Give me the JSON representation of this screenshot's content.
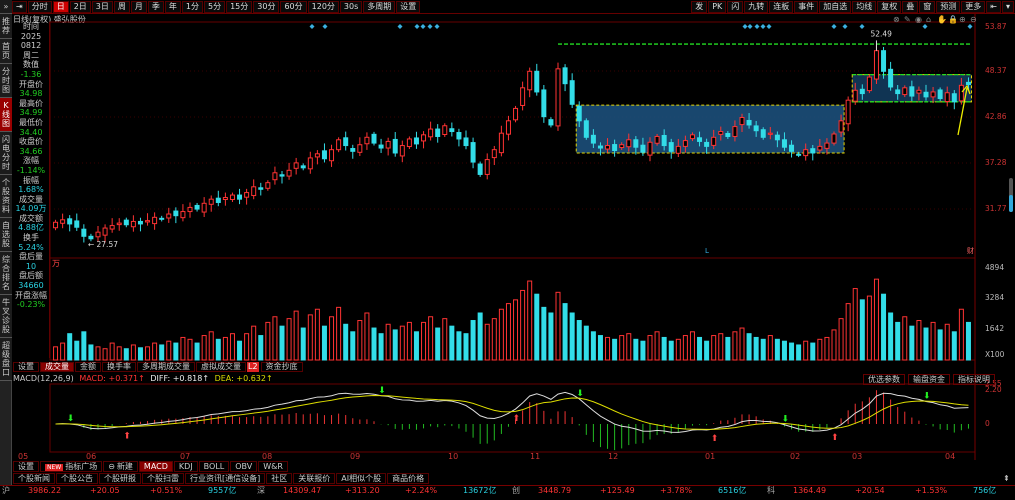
{
  "toolbar": {
    "items": [
      "分时",
      "日",
      "2日",
      "3日",
      "周",
      "月",
      "季",
      "年",
      "1分",
      "5分",
      "15分",
      "30分",
      "60分",
      "120分",
      "30s",
      "多周期",
      "设置"
    ],
    "active": 1,
    "right_items": [
      "发",
      "PK",
      "闪",
      "九转",
      "连板",
      "事件",
      "加自选",
      "均线",
      "复权",
      "叠",
      "窗",
      "预测",
      "更多"
    ]
  },
  "title": "日线(复权)  盛弘股份",
  "sidebar": [
    "推荐",
    "首页",
    "分时图",
    "K线图",
    "闪电分时",
    "个股资料",
    "自选股",
    "综合排名",
    "牛叉诊股",
    "超级盘口"
  ],
  "sidebar_active": 3,
  "info": [
    {
      "label": "时间",
      "value": "2025",
      "value2": "0812",
      "value3": "周二",
      "cls": "lbl"
    },
    {
      "label": "数值",
      "value": "-1.36",
      "cls": "g"
    },
    {
      "label": "开盘价",
      "value": "34.98",
      "cls": "g"
    },
    {
      "label": "最高价",
      "value": "34.99",
      "cls": "g"
    },
    {
      "label": "最低价",
      "value": "34.40",
      "cls": "g"
    },
    {
      "label": "收盘价",
      "value": "34.66",
      "cls": "g"
    },
    {
      "label": "涨幅",
      "value": "-1.14%",
      "cls": "g"
    },
    {
      "label": "振幅",
      "value": "1.68%",
      "cls": "c"
    },
    {
      "label": "成交量",
      "value": "14.09万",
      "cls": "c"
    },
    {
      "label": "成交额",
      "value": "4.88亿",
      "cls": "c"
    },
    {
      "label": "换手",
      "value": "5.24%",
      "cls": "c"
    },
    {
      "label": "盘后量",
      "value": "10",
      "cls": "c"
    },
    {
      "label": "盘后额",
      "value": "34660",
      "cls": "c"
    },
    {
      "label": "开盘涨幅",
      "value": "-0.23%",
      "cls": "g"
    }
  ],
  "volume_unit": "万",
  "volume_tabs": [
    "设置",
    "成交量",
    "金额",
    "换手率",
    "多周期成交量",
    "虚拟成交量",
    "资金抄底"
  ],
  "volume_active": 1,
  "l2_badge": "L2",
  "macd": {
    "name": "MACD(12,26,9)",
    "macd": "MACD: +0.371↑",
    "diff": "DIFF: +0.818↑",
    "dea": "DEA: +0.632↑",
    "buttons": [
      "优选参数",
      "输盘资金",
      "指标说明"
    ],
    "axis": [
      "2.55",
      "2.20",
      "0"
    ]
  },
  "months": [
    "05",
    "06",
    "07",
    "08",
    "09",
    "10",
    "11",
    "12",
    "01",
    "02",
    "03",
    "04"
  ],
  "indicator_tabs": [
    "设置",
    "指标广场",
    "新建",
    "MACD",
    "KDJ",
    "BOLL",
    "OBV",
    "W&R"
  ],
  "new_badge": "NEW",
  "news_tabs": [
    "个股新闻",
    "个股公告",
    "个股研报",
    "个股扫雷",
    "行业资讯[通信设备]",
    "社区",
    "关联报价",
    "AI相似个股",
    "商品价格"
  ],
  "ticker": [
    {
      "name": "沪",
      "price": "3986.22",
      "chg": "+20.05",
      "pct": "+0.51%",
      "amt": "9557亿"
    },
    {
      "name": "深",
      "price": "14309.47",
      "chg": "+313.20",
      "pct": "+2.24%",
      "amt": "13672亿"
    },
    {
      "name": "创",
      "price": "3448.79",
      "chg": "+125.49",
      "pct": "+3.78%",
      "amt": "6516亿"
    },
    {
      "name": "科",
      "price": "1364.49",
      "chg": "+20.54",
      "pct": "+1.53%",
      "amt": "756亿"
    }
  ],
  "colors": {
    "up": "#ff3333",
    "down": "#33dde8",
    "box": "#1c4f7a",
    "dash_yellow": "#e8d800",
    "dash_green": "#22dd22",
    "axis": "#cc3333"
  },
  "chart_data": {
    "type": "candlestick",
    "price_axis": [
      "53.87",
      "48.37",
      "42.86",
      "37.28",
      "31.77"
    ],
    "price_range": [
      31.77,
      53.87
    ],
    "volume_axis": [
      "4894",
      "3284",
      "1642",
      "X100"
    ],
    "max_label": "52.49",
    "min_label": "27.57",
    "fin_marker": "财",
    "l_marker": "L",
    "closes": [
      30.2,
      30.5,
      30.0,
      29.6,
      28.5,
      28.2,
      29.0,
      29.5,
      29.8,
      30.1,
      29.9,
      30.3,
      30.0,
      30.4,
      30.8,
      30.6,
      31.2,
      31.0,
      31.5,
      32.0,
      31.8,
      32.5,
      33.0,
      32.6,
      33.2,
      33.5,
      33.0,
      33.8,
      34.5,
      34.2,
      35.0,
      36.2,
      35.8,
      36.5,
      37.4,
      36.8,
      38.0,
      38.5,
      37.9,
      39.0,
      40.2,
      39.5,
      38.8,
      39.6,
      40.5,
      39.8,
      39.2,
      40.0,
      38.6,
      39.5,
      40.3,
      39.7,
      40.8,
      41.5,
      40.6,
      41.9,
      41.2,
      40.3,
      39.5,
      37.5,
      36.0,
      37.8,
      39.0,
      41.0,
      42.5,
      44.0,
      46.5,
      48.5,
      46.0,
      43.0,
      42.0,
      48.8,
      47.0,
      44.5,
      42.5,
      40.5,
      39.8,
      39.2,
      39.5,
      38.9,
      39.6,
      40.2,
      39.3,
      38.7,
      39.9,
      40.6,
      39.5,
      38.8,
      39.4,
      40.1,
      40.8,
      40.0,
      39.4,
      40.5,
      41.2,
      40.6,
      41.8,
      42.9,
      42.0,
      41.3,
      40.5,
      41.0,
      40.2,
      39.3,
      38.8,
      38.4,
      39.0,
      38.6,
      39.4,
      39.8,
      40.9,
      42.5,
      45.0,
      46.2,
      45.8,
      47.8,
      51.0,
      48.5,
      46.6,
      45.8,
      46.5,
      45.5,
      46.2,
      45.4,
      46.0,
      45.2,
      45.9,
      44.8,
      46.8,
      46.9
    ],
    "volumes": [
      700,
      900,
      1400,
      1000,
      1500,
      800,
      700,
      600,
      900,
      700,
      600,
      800,
      650,
      700,
      900,
      800,
      1000,
      900,
      1200,
      1100,
      900,
      1300,
      1500,
      1100,
      1200,
      1400,
      1000,
      1400,
      1800,
      1300,
      2000,
      2300,
      1800,
      2200,
      2600,
      1700,
      2400,
      2700,
      1800,
      2300,
      2800,
      1900,
      1500,
      2100,
      2500,
      1700,
      1400,
      1900,
      1600,
      1800,
      2000,
      1500,
      2000,
      2300,
      1700,
      2200,
      1800,
      1500,
      1400,
      2100,
      2500,
      1900,
      2200,
      2700,
      3000,
      3200,
      3700,
      4200,
      3500,
      2800,
      2500,
      3600,
      3000,
      2500,
      2100,
      1800,
      1500,
      1300,
      1200,
      1100,
      1300,
      1400,
      1100,
      1000,
      1300,
      1500,
      1200,
      1000,
      1100,
      1300,
      1500,
      1200,
      1000,
      1300,
      1400,
      1200,
      1500,
      1700,
      1400,
      1200,
      1100,
      1300,
      1100,
      1000,
      900,
      800,
      1000,
      900,
      1100,
      1200,
      1600,
      2200,
      3000,
      3800,
      3200,
      3400,
      4300,
      3500,
      2500,
      2000,
      2300,
      1800,
      2100,
      1700,
      2000,
      1600,
      1900,
      1500,
      2700,
      2000
    ],
    "boxes": [
      {
        "from": 74,
        "to": 111,
        "low": 38.6,
        "high": 44.4
      },
      {
        "from": 113,
        "to": 129,
        "low": 44.8,
        "high": 48.1
      }
    ],
    "resistance": {
      "from": 71,
      "to": 129,
      "price": 51.8
    }
  }
}
